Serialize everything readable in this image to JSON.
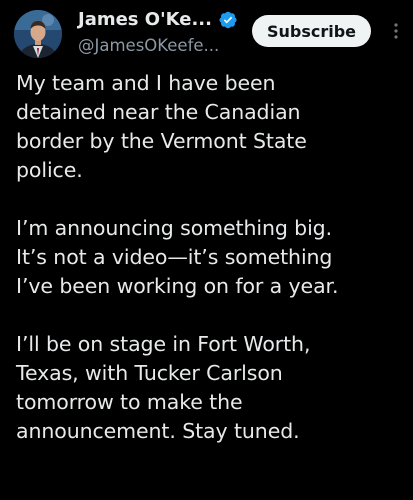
{
  "author": {
    "display_name": "James O'Ke...",
    "handle": "@JamesOKeefe...",
    "verified": true,
    "avatar_icon": "profile-photo"
  },
  "actions": {
    "subscribe_label": "Subscribe",
    "more_icon": "more-vertical-icon"
  },
  "tweet": {
    "paragraphs": [
      {
        "lines": [
          "My team and I have been",
          "detained near the Canadian",
          "border by the Vermont State",
          "police."
        ]
      },
      {
        "lines": [
          "I’m announcing something big.",
          "It’s not a video—it’s something",
          "I’ve been working on for a year."
        ]
      },
      {
        "lines": [
          "I’ll be on stage in Fort Worth,",
          "Texas, with Tucker Carlson",
          "tomorrow to make the",
          "announcement. Stay tuned."
        ]
      }
    ]
  },
  "colors": {
    "background": "#000000",
    "text_primary": "#e7e9ea",
    "text_secondary": "#8b98a5",
    "verified_blue": "#1d9bf0",
    "button_bg": "#eff3f4",
    "button_text": "#0f1419"
  }
}
